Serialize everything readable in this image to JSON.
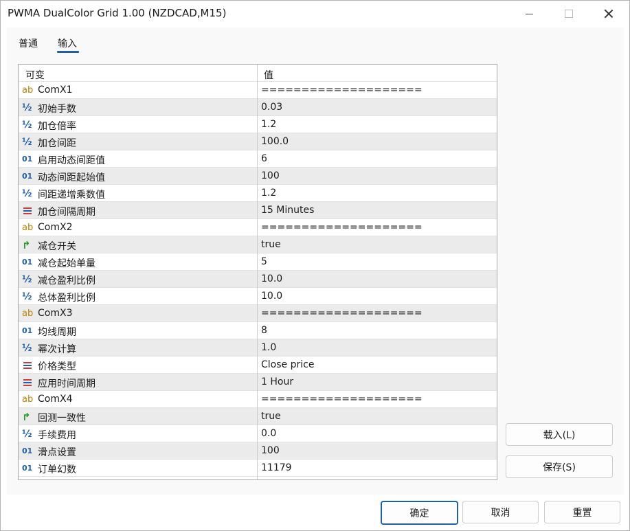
{
  "window": {
    "title": "PWMA DualColor Grid 1.00 (NZDCAD,M15)"
  },
  "tabs": [
    {
      "label": "普通"
    },
    {
      "label": "输入"
    }
  ],
  "grid": {
    "header_name": "可变",
    "header_value": "值",
    "rows": [
      {
        "icon": "ab",
        "name": "ComX1",
        "value": "===================="
      },
      {
        "icon": "half",
        "name": "初始手数",
        "value": "0.03"
      },
      {
        "icon": "half",
        "name": "加仓倍率",
        "value": "1.2"
      },
      {
        "icon": "half",
        "name": "加仓间距",
        "value": "100.0"
      },
      {
        "icon": "01",
        "name": "启用动态间距值",
        "value": "6"
      },
      {
        "icon": "01",
        "name": "动态间距起始值",
        "value": "100"
      },
      {
        "icon": "half",
        "name": "间距递增乘数值",
        "value": "1.2"
      },
      {
        "icon": "enum",
        "name": "加仓间隔周期",
        "value": "15 Minutes"
      },
      {
        "icon": "ab",
        "name": "ComX2",
        "value": "===================="
      },
      {
        "icon": "bool",
        "name": "减仓开关",
        "value": "true"
      },
      {
        "icon": "01",
        "name": "减仓起始单量",
        "value": "5"
      },
      {
        "icon": "half",
        "name": "减仓盈利比例",
        "value": "10.0"
      },
      {
        "icon": "half",
        "name": "总体盈利比例",
        "value": "10.0"
      },
      {
        "icon": "ab",
        "name": "ComX3",
        "value": "===================="
      },
      {
        "icon": "01",
        "name": "均线周期",
        "value": "8"
      },
      {
        "icon": "half",
        "name": "幂次计算",
        "value": "1.0"
      },
      {
        "icon": "enum",
        "name": "价格类型",
        "value": "Close price"
      },
      {
        "icon": "enum",
        "name": "应用时间周期",
        "value": "1 Hour"
      },
      {
        "icon": "ab",
        "name": "ComX4",
        "value": "===================="
      },
      {
        "icon": "bool",
        "name": "回测一致性",
        "value": "true"
      },
      {
        "icon": "half",
        "name": "手续费用",
        "value": "0.0"
      },
      {
        "icon": "01",
        "name": "滑点设置",
        "value": "100"
      },
      {
        "icon": "01",
        "name": "订单幻数",
        "value": "11179"
      }
    ]
  },
  "side_buttons": {
    "load": "载入(L)",
    "save": "保存(S)"
  },
  "footer_buttons": {
    "ok": "确定",
    "cancel": "取消",
    "reset": "重置"
  },
  "icons": {
    "ab": {
      "glyph": "ab",
      "name": "string-type-icon"
    },
    "half": {
      "glyph": "½",
      "name": "double-type-icon"
    },
    "01": {
      "glyph": "01",
      "name": "integer-type-icon"
    },
    "enum": {
      "glyph": "",
      "name": "enum-type-icon"
    },
    "bool": {
      "glyph": "↱",
      "name": "bool-type-icon"
    }
  },
  "colors": {
    "accent": "#1f5fa8",
    "string_icon": "#c08000",
    "bool_icon": "#2a9d2a",
    "row_alt": "#ebebeb"
  }
}
